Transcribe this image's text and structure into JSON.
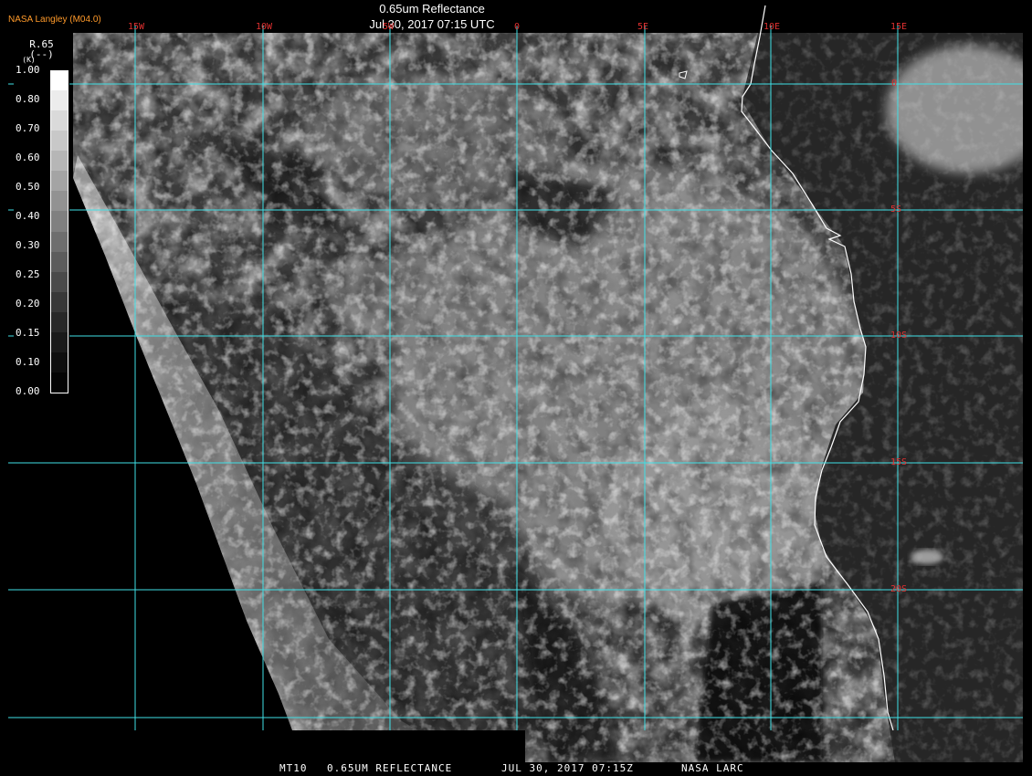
{
  "header": {
    "credit": "NASA Langley (M04.0)",
    "title": "0.65um Reflectance",
    "datetime": "Jul 30, 2017 07:15 UTC"
  },
  "footer": {
    "satellite": "MT10",
    "product": "0.65UM REFLECTANCE",
    "datetime": "JUL 30, 2017 07:15Z",
    "source": "NASA LARC"
  },
  "legend": {
    "unit_line1": "R.65",
    "unit_line2": "(--)",
    "tiny_label": "(K)",
    "labels": [
      "1.00",
      "0.80",
      "0.70",
      "0.60",
      "0.50",
      "0.40",
      "0.30",
      "0.25",
      "0.20",
      "0.15",
      "0.10",
      "0.00"
    ],
    "gray_levels": [
      255,
      236,
      218,
      200,
      182,
      164,
      146,
      128,
      110,
      92,
      74,
      56,
      40,
      26,
      14,
      4
    ]
  },
  "grid": {
    "color": "#3fe0e6",
    "lon_labels": [
      "15W",
      "10W",
      "5W",
      "0",
      "5E",
      "10E",
      "15E"
    ],
    "lat_labels": [
      "0",
      "5S",
      "10S",
      "15S",
      "20S"
    ]
  },
  "colors": {
    "coastline": "#ffffff",
    "grid_label": "#e03030",
    "credit": "#ff9a2a"
  }
}
